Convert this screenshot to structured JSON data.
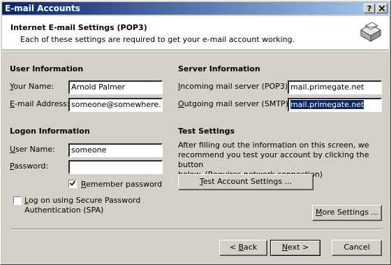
{
  "window": {
    "title": "E-mail Accounts",
    "help_button": "?",
    "close_button": "X"
  },
  "header": {
    "title": "Internet E-mail Settings (POP3)",
    "subtitle": "Each of these settings are required to get your e-mail account working."
  },
  "user_info": {
    "heading": "User Information",
    "name_label_accel": "Y",
    "name_label_rest": "our Name:",
    "name_value": "Arnold Palmer",
    "email_label_accel": "E",
    "email_label_rest": "-mail Address:",
    "email_value": "someone@somewhere.com"
  },
  "server_info": {
    "heading": "Server Information",
    "incoming_label_accel": "I",
    "incoming_label_rest": "ncoming mail server (POP3):",
    "incoming_value": "mail.primegate.net",
    "outgoing_label_accel": "O",
    "outgoing_label_rest": "utgoing mail server (SMTP):",
    "outgoing_value": "mail.primegate.net"
  },
  "logon_info": {
    "heading": "Logon Information",
    "username_label_accel": "U",
    "username_label_rest": "ser Name:",
    "username_value": "someone",
    "password_label_accel": "P",
    "password_label_rest": "assword:",
    "password_value": "",
    "remember_label_accel": "R",
    "remember_label_rest": "emember password",
    "remember_checked": true,
    "spa_label_line1_accel": "L",
    "spa_label_line1_rest": "og on using Secure Password",
    "spa_label_line2": "Authentication (SPA)",
    "spa_checked": false
  },
  "test_settings": {
    "heading": "Test Settings",
    "desc_line1": "After filling out the information on this screen, we",
    "desc_line2": "recommend you test your account by clicking the button",
    "desc_line3": "below. (Requires network connection)",
    "button_accel": "T",
    "button_rest": "est Account Settings ..."
  },
  "buttons": {
    "more_settings_accel": "M",
    "more_settings_rest": "ore Settings ...",
    "back_prefix": "< ",
    "back_accel": "B",
    "back_rest": "ack",
    "next_accel": "N",
    "next_rest": "ext >",
    "cancel": "Cancel"
  }
}
